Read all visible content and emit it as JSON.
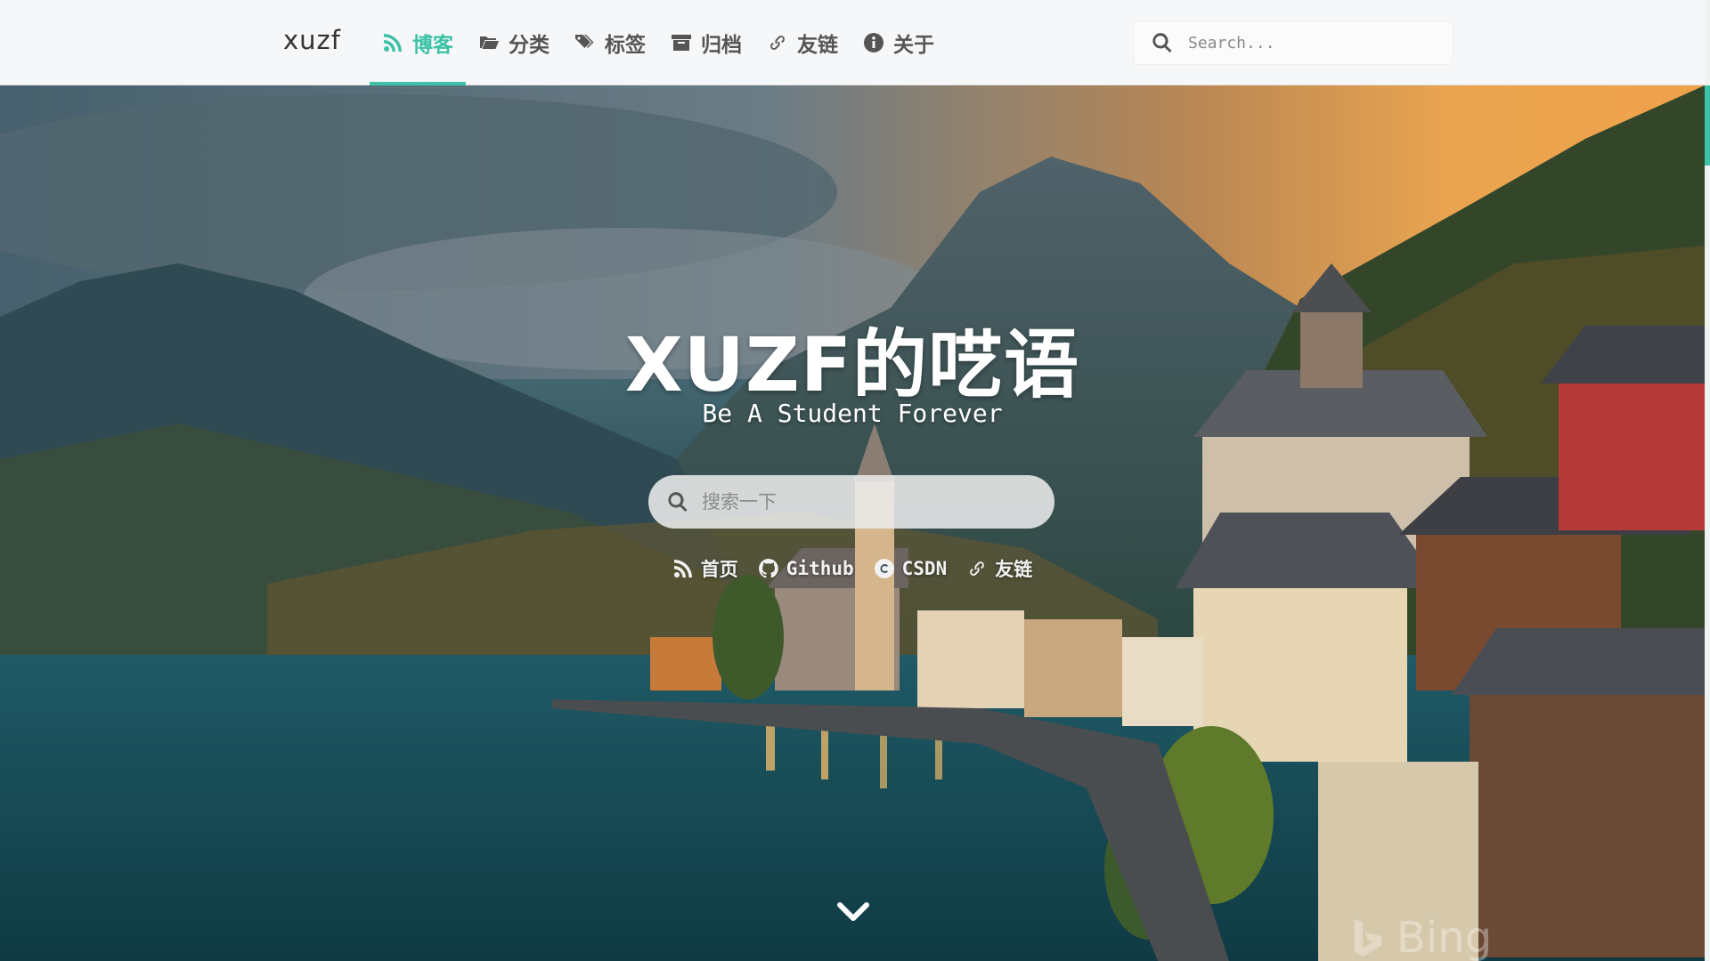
{
  "navbar": {
    "brand": "xuzf",
    "items": [
      {
        "label": "博客",
        "icon": "rss-icon",
        "active": true
      },
      {
        "label": "分类",
        "icon": "folder-icon",
        "active": false
      },
      {
        "label": "标签",
        "icon": "tags-icon",
        "active": false
      },
      {
        "label": "归档",
        "icon": "archive-icon",
        "active": false
      },
      {
        "label": "友链",
        "icon": "link-icon",
        "active": false
      },
      {
        "label": "关于",
        "icon": "info-icon",
        "active": false
      }
    ],
    "search": {
      "placeholder": "Search..."
    }
  },
  "hero": {
    "title": "XUZF的呓语",
    "subtitle": "Be A Student Forever",
    "search": {
      "placeholder": "搜索一下"
    },
    "links": [
      {
        "label": "首页",
        "icon": "rss-icon"
      },
      {
        "label": "Github",
        "icon": "github-icon"
      },
      {
        "label": "CSDN",
        "icon": "csdn-icon"
      },
      {
        "label": "友链",
        "icon": "link-icon"
      }
    ],
    "scroll_icon": "chevron-down-icon",
    "watermark": "Bing",
    "background": "mountain-lake-village-photo"
  },
  "colors": {
    "accent": "#3ec2a7",
    "navbar_bg": "#f6f7f8",
    "nav_text": "#555555"
  }
}
